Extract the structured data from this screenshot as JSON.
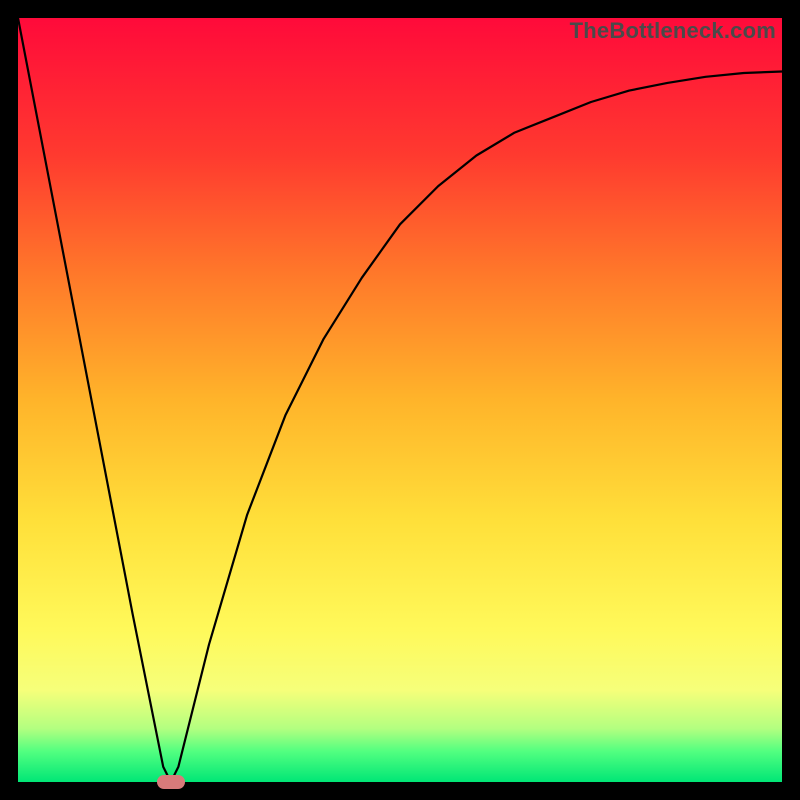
{
  "watermark": "TheBottleneck.com",
  "colors": {
    "gradient_top": "#ff0a3a",
    "gradient_bottom": "#00e676",
    "curve": "#000000",
    "marker": "#d87a7a",
    "frame": "#000000"
  },
  "chart_data": {
    "type": "line",
    "title": "",
    "xlabel": "",
    "ylabel": "",
    "xlim": [
      0,
      100
    ],
    "ylim": [
      0,
      100
    ],
    "grid": false,
    "curve": {
      "name": "bottleneck-curve",
      "x": [
        0,
        5,
        10,
        15,
        19,
        20,
        21,
        25,
        30,
        35,
        40,
        45,
        50,
        55,
        60,
        65,
        70,
        75,
        80,
        85,
        90,
        95,
        100
      ],
      "y": [
        100,
        74,
        48,
        22,
        2,
        0,
        2,
        18,
        35,
        48,
        58,
        66,
        73,
        78,
        82,
        85,
        87,
        89,
        90.5,
        91.5,
        92.3,
        92.8,
        93
      ]
    },
    "marker": {
      "x": 20,
      "y": 0
    },
    "background_meaning": "red=high bottleneck, green=no bottleneck"
  }
}
